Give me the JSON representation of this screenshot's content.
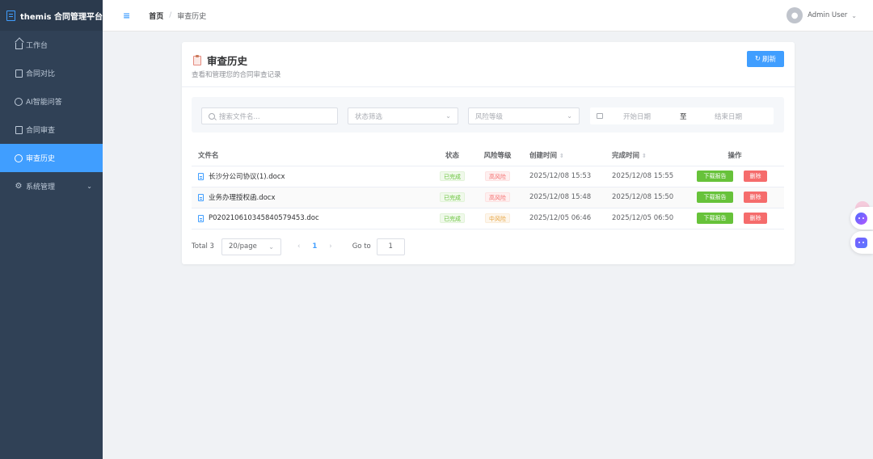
{
  "app": {
    "title": "themis 合同管理平台"
  },
  "sidebar": {
    "items": [
      {
        "label": "工作台",
        "icon": "home-icon"
      },
      {
        "label": "合同对比",
        "icon": "document-icon"
      },
      {
        "label": "AI智能问答",
        "icon": "chat-icon"
      },
      {
        "label": "合同审查",
        "icon": "document-icon"
      },
      {
        "label": "审查历史",
        "icon": "clock-icon",
        "active": true
      },
      {
        "label": "系统管理",
        "icon": "gear-icon",
        "expandable": true
      }
    ]
  },
  "header": {
    "menu_toggle": "≡",
    "breadcrumb": {
      "home": "首页",
      "separator": "/",
      "current": "审查历史"
    },
    "user": {
      "name": "Admin User"
    }
  },
  "page": {
    "title": "审查历史",
    "subtitle": "查看和管理您的合同审查记录",
    "refresh_label": "刷新"
  },
  "filters": {
    "search_placeholder": "搜索文件名...",
    "status_placeholder": "状态筛选",
    "risk_placeholder": "风险等级",
    "start_date_placeholder": "开始日期",
    "range_separator": "至",
    "end_date_placeholder": "结束日期"
  },
  "table": {
    "headers": {
      "filename": "文件名",
      "status": "状态",
      "risk": "风险等级",
      "created": "创建时间",
      "completed": "完成时间",
      "actions": "操作"
    },
    "rows": [
      {
        "filename": "长沙分公司协议(1).docx",
        "status": "已完成",
        "risk": "高风险",
        "created": "2025/12/08 15:53",
        "completed": "2025/12/08 15:55",
        "download": "下载报告",
        "delete": "删除"
      },
      {
        "filename": "业务办理授权函.docx",
        "status": "已完成",
        "risk": "高风险",
        "created": "2025/12/08 15:48",
        "completed": "2025/12/08 15:50",
        "download": "下载报告",
        "delete": "删除"
      },
      {
        "filename": "P020210610345840579453.doc",
        "status": "已完成",
        "risk": "中风险",
        "created": "2025/12/05 06:46",
        "completed": "2025/12/05 06:50",
        "download": "下载报告",
        "delete": "删除"
      }
    ]
  },
  "pagination": {
    "total": "Total 3",
    "page_size": "20/page",
    "prev": "‹",
    "current_page": "1",
    "next": "›",
    "goto_label": "Go to",
    "goto_value": "1"
  },
  "colors": {
    "sidebar_bg": "#304156",
    "accent": "#409eff",
    "success": "#67c23a",
    "danger": "#f56c6c",
    "warning": "#e6a23c"
  }
}
